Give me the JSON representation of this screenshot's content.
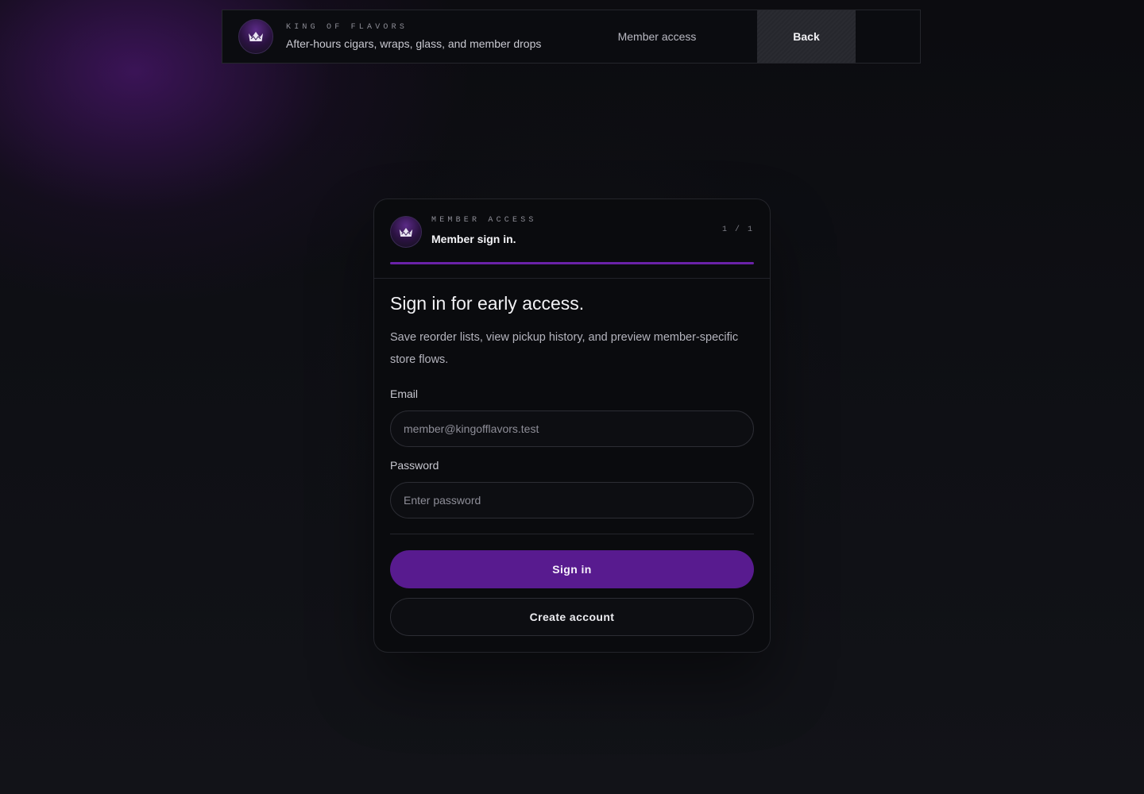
{
  "colors": {
    "accent": "#581b8f",
    "progress": "#6a22a8",
    "background": "#0e0f13",
    "card": "#0a0b0e"
  },
  "header": {
    "logo_icon": "crown-icon",
    "kicker": "KING OF FLAVORS",
    "tagline": "After-hours cigars, wraps, glass, and member drops",
    "nav_link": "Member access",
    "back_label": "Back"
  },
  "card": {
    "logo_icon": "crown-icon",
    "kicker": "MEMBER ACCESS",
    "title": "Member sign in.",
    "step": "1 / 1",
    "progress": 1.0,
    "heading": "Sign in for early access.",
    "description": "Save reorder lists, view pickup history, and preview member-specific store flows.",
    "email": {
      "label": "Email",
      "value": "",
      "placeholder": "member@kingofflavors.test"
    },
    "password": {
      "label": "Password",
      "value": "",
      "placeholder": "Enter password"
    },
    "sign_in_label": "Sign in",
    "create_account_label": "Create account"
  }
}
